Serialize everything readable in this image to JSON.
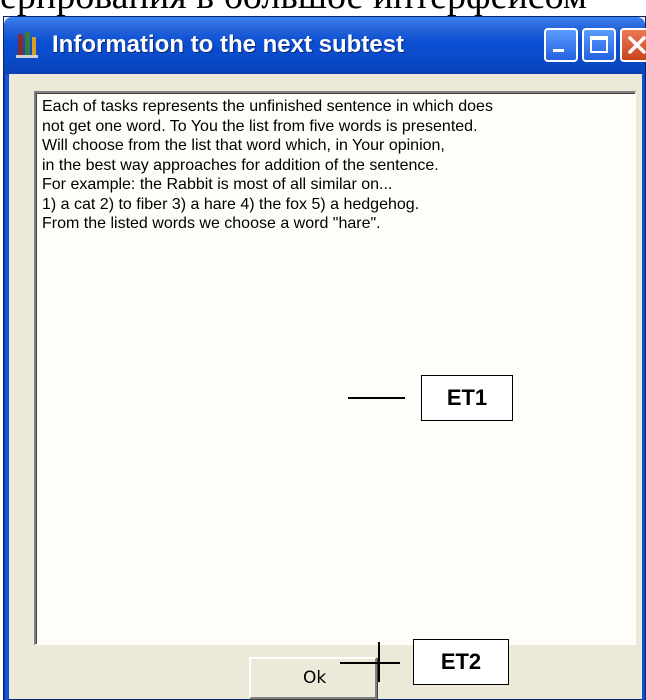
{
  "background_caption": "ерпрования в большое интерфейсом",
  "window": {
    "title": "Information to the next subtest",
    "controls": {
      "minimize_icon": "minimize-icon",
      "maximize_icon": "maximize-icon",
      "close_icon": "close-icon"
    }
  },
  "memo": {
    "lines": [
      "Each of tasks represents the unfinished sentence in which does",
      "not get one word. To You the list from five words is presented.",
      "Will choose from the list that word which, in Your opinion,",
      "in the best way approaches for addition of the sentence.",
      "For example: the Rabbit is most of all similar on...",
      "1) a cat 2) to fiber 3) a hare 4) the fox 5) a hedgehog.",
      "From the listed words we choose a word \"hare\"."
    ]
  },
  "annotations": {
    "et1": "ET1",
    "et2": "ET2"
  },
  "buttons": {
    "ok_label": "Ok"
  },
  "colors": {
    "titlebar": "#0a4ed3",
    "window_face": "#ece9d8",
    "memo_background": "#fffdf8",
    "close_button": "#c8431e"
  }
}
